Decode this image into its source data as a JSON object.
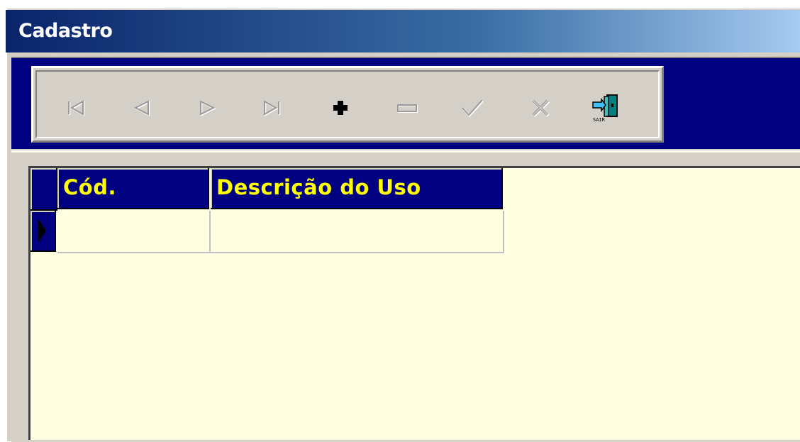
{
  "window": {
    "title": "Cadastro"
  },
  "toolbar": {
    "buttons": [
      {
        "name": "first-record-button",
        "icon": "first-record-icon",
        "enabled": false
      },
      {
        "name": "prior-record-button",
        "icon": "prior-record-icon",
        "enabled": false
      },
      {
        "name": "next-record-button",
        "icon": "next-record-icon",
        "enabled": false
      },
      {
        "name": "last-record-button",
        "icon": "last-record-icon",
        "enabled": false
      },
      {
        "name": "insert-record-button",
        "icon": "plus-icon",
        "enabled": true
      },
      {
        "name": "delete-record-button",
        "icon": "minus-icon",
        "enabled": false
      },
      {
        "name": "post-record-button",
        "icon": "check-icon",
        "enabled": false
      },
      {
        "name": "cancel-record-button",
        "icon": "x-icon",
        "enabled": false
      },
      {
        "name": "exit-button",
        "icon": "exit-door-icon",
        "enabled": true
      }
    ]
  },
  "grid": {
    "columns": [
      {
        "label": "Cód."
      },
      {
        "label": "Descrição do Uso"
      }
    ],
    "rows": [
      {
        "cod": "",
        "descricao": ""
      }
    ]
  },
  "colors": {
    "title_bar_start": "#0a246a",
    "panel_background": "#000080",
    "header_text": "#ffff00",
    "grid_background": "#ffffe1",
    "face": "#d4d0c8"
  }
}
